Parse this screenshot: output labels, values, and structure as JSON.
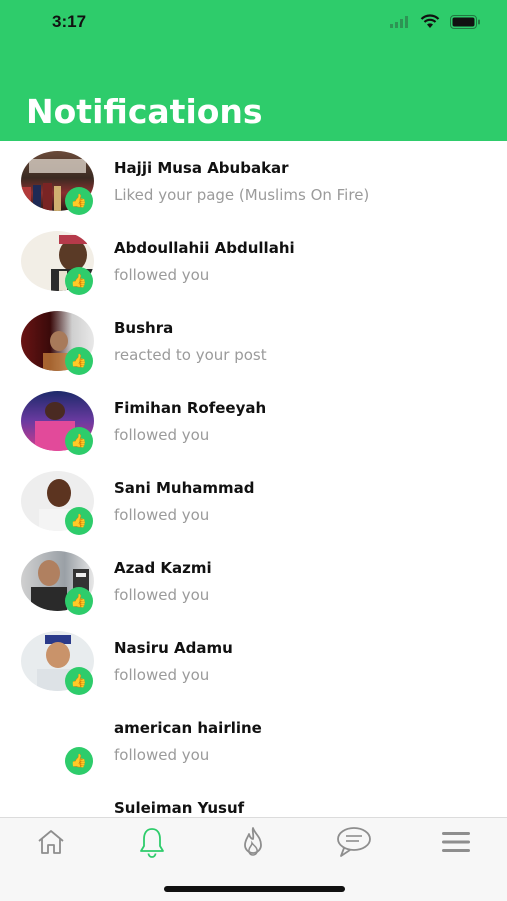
{
  "status_bar": {
    "time": "3:17"
  },
  "header": {
    "title": "Notifications"
  },
  "colors": {
    "accent": "#2ecc6b",
    "tab_inactive": "#8e8e8e"
  },
  "notifications": [
    {
      "name": "Hajji Musa Abubakar",
      "action": "Liked your page (Muslims On Fire)",
      "badge_icon": "thumbs-up-icon"
    },
    {
      "name": "Abdoullahii Abdullahi",
      "action": "followed you",
      "badge_icon": "thumbs-up-icon"
    },
    {
      "name": "Bushra",
      "action": "reacted to your post",
      "badge_icon": "thumbs-up-icon"
    },
    {
      "name": "Fimihan Rofeeyah",
      "action": "followed you",
      "badge_icon": "thumbs-up-icon"
    },
    {
      "name": "Sani Muhammad",
      "action": "followed you",
      "badge_icon": "thumbs-up-icon"
    },
    {
      "name": "Azad Kazmi",
      "action": "followed you",
      "badge_icon": "thumbs-up-icon"
    },
    {
      "name": "Nasiru Adamu",
      "action": "followed you",
      "badge_icon": "thumbs-up-icon"
    },
    {
      "name": "american hairline",
      "action": "followed you",
      "badge_icon": "thumbs-up-icon"
    },
    {
      "name": "Suleiman Yusuf",
      "action": "",
      "badge_icon": "thumbs-up-icon"
    }
  ],
  "tabbar": {
    "items": [
      {
        "icon": "home-icon",
        "active": false
      },
      {
        "icon": "bell-icon",
        "active": true
      },
      {
        "icon": "flame-icon",
        "active": false
      },
      {
        "icon": "chat-bubble-icon",
        "active": false
      },
      {
        "icon": "menu-icon",
        "active": false
      }
    ]
  }
}
